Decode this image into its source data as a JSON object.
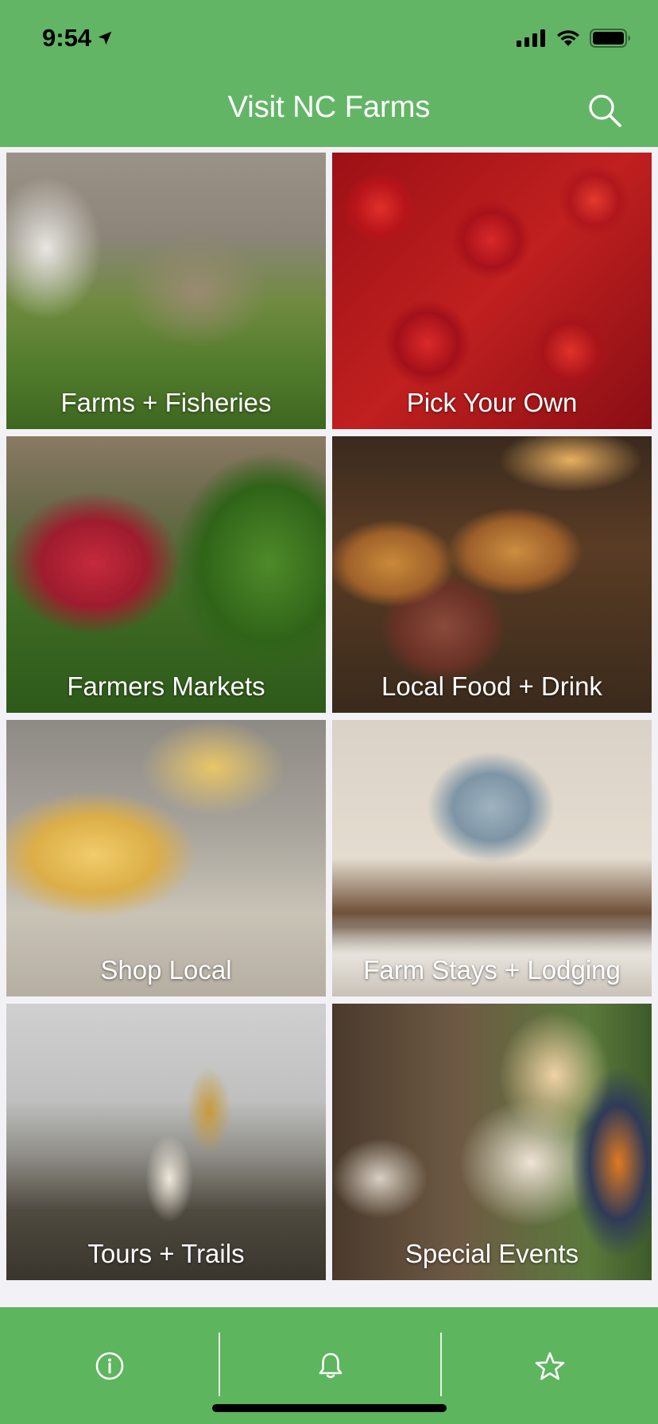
{
  "status_bar": {
    "time": "9:54"
  },
  "header": {
    "title": "Visit NC Farms"
  },
  "tiles": [
    {
      "label": "Farms + Fisheries"
    },
    {
      "label": "Pick Your Own"
    },
    {
      "label": "Farmers Markets"
    },
    {
      "label": "Local Food + Drink"
    },
    {
      "label": "Shop Local"
    },
    {
      "label": "Farm Stays + Lodging"
    },
    {
      "label": "Tours + Trails"
    },
    {
      "label": "Special Events"
    }
  ],
  "tab_bar": {
    "items": [
      {
        "icon": "info-icon"
      },
      {
        "icon": "bell-icon"
      },
      {
        "icon": "star-icon"
      }
    ]
  },
  "colors": {
    "header_green": "#63b566",
    "tabbar_green": "#5db55e",
    "page_background": "#f2f1f6"
  }
}
